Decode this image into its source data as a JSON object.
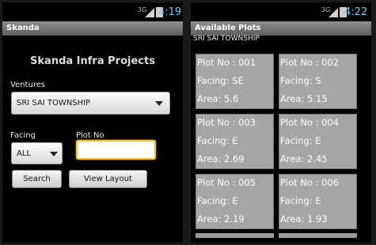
{
  "screen1": {
    "status": {
      "network": "3G",
      "time": "4:19"
    },
    "titlebar": "Skanda",
    "app_title": "Skanda Infra Projects",
    "ventures_label": "Ventures",
    "ventures_selected": "SRI SAI TOWNSHIP",
    "facing_label": "Facing",
    "facing_selected": "ALL",
    "plotno_label": "Plot No",
    "plotno_value": "",
    "search_button": "Search",
    "view_layout_button": "View Layout"
  },
  "screen2": {
    "status": {
      "network": "3G",
      "time": "4:22"
    },
    "titlebar": "Available Plots",
    "township": "SRI SAI TOWNSHIP",
    "plots": [
      {
        "plot": "Plot No : 001",
        "facing": "Facing: SE",
        "area": "Area: 5.6"
      },
      {
        "plot": "Plot No : 002",
        "facing": "Facing: S",
        "area": "Area: 5.15"
      },
      {
        "plot": "Plot No : 003",
        "facing": "Facing: E",
        "area": "Area: 2.69"
      },
      {
        "plot": "Plot No : 004",
        "facing": "Facing: E",
        "area": "Area: 2.45"
      },
      {
        "plot": "Plot No : 005",
        "facing": "Facing: E",
        "area": "Area: 2.19"
      },
      {
        "plot": "Plot No : 006",
        "facing": "Facing: E",
        "area": "Area: 1.93"
      }
    ]
  },
  "colors": {
    "time": "#6ec9ef",
    "titlebar": "#7a7a7a",
    "card": "#a5a5a5",
    "input_focus": "#f0c040"
  }
}
